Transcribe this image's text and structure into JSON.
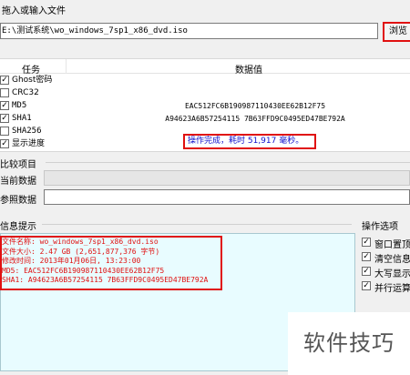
{
  "drop": {
    "label": "拖入或输入文件",
    "path": "E:\\测试系统\\wo_windows_7sp1_x86_dvd.iso",
    "browse_label": "浏览"
  },
  "table": {
    "headers": {
      "task": "任务",
      "data": "数据值"
    },
    "rows": [
      {
        "name": "Ghost密码",
        "checked": true,
        "value": ""
      },
      {
        "name": "CRC32",
        "checked": false,
        "value": ""
      },
      {
        "name": "MD5",
        "checked": true,
        "value": "EAC512FC6B190987110430EE62B12F75"
      },
      {
        "name": "SHA1",
        "checked": true,
        "value": "A94623A6B57254115 7B63FFD9C0495ED47BE792A"
      },
      {
        "name": "SHA256",
        "checked": false,
        "value": ""
      },
      {
        "name": "显示进度",
        "checked": true,
        "value": ""
      }
    ],
    "status": "操作完成，耗时 51,917 毫秒。"
  },
  "compare": {
    "section_label": "比较项目",
    "current_label": "当前数据",
    "reference_label": "参照数据"
  },
  "info": {
    "section_label": "信息提示",
    "lines": [
      "文件名称: wo_windows_7sp1_x86_dvd.iso",
      "文件大小: 2.47 GB (2,651,877,376 字节)",
      "修改时间: 2013年01月06日, 13:23:00",
      "MD5: EAC512FC6B190987110430EE62B12F75",
      "SHA1: A94623A6B57254115 7B63FFD9C0495ED47BE792A"
    ]
  },
  "options": {
    "section_label": "操作选项",
    "items": [
      {
        "label": "窗口置顶",
        "checked": true
      },
      {
        "label": "清空信息",
        "checked": true
      },
      {
        "label": "大写显示",
        "checked": true
      },
      {
        "label": "并行运算",
        "checked": true
      }
    ]
  },
  "watermark": "软件技巧"
}
